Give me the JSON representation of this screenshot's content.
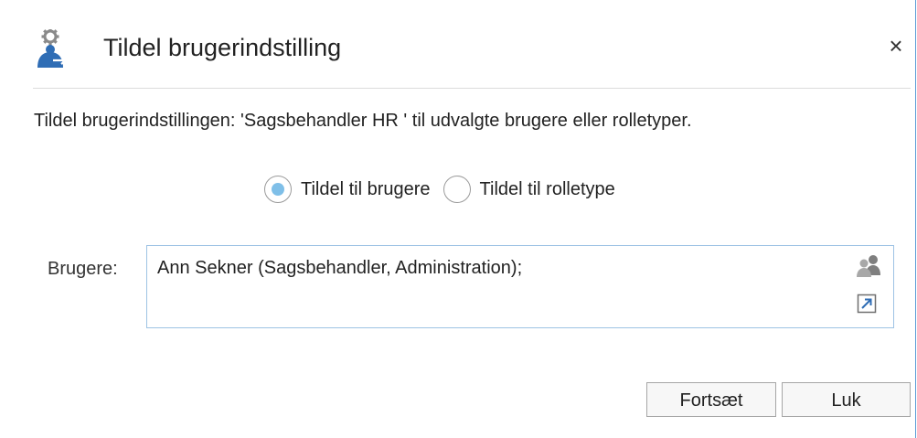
{
  "dialog": {
    "title": "Tildel brugerindstilling",
    "close_label": "×",
    "description": "Tildel brugerindstillingen: 'Sagsbehandler HR ' til udvalgte brugere eller rolletyper.",
    "assign_mode": {
      "options": [
        {
          "label": "Tildel til brugere",
          "selected": true
        },
        {
          "label": "Tildel til rolletype",
          "selected": false
        }
      ]
    },
    "users": {
      "label": "Brugere:",
      "value": "Ann Sekner (Sagsbehandler, Administration);",
      "icons": [
        "users-icon",
        "expand-icon"
      ]
    },
    "buttons": {
      "continue_label": "Fortsæt",
      "close_label": "Luk"
    },
    "colors": {
      "accent": "#7fbfe8",
      "field_border": "#9ec3e4",
      "window_border": "#5b9bd5"
    },
    "header_icon": "gear-user-icon"
  }
}
